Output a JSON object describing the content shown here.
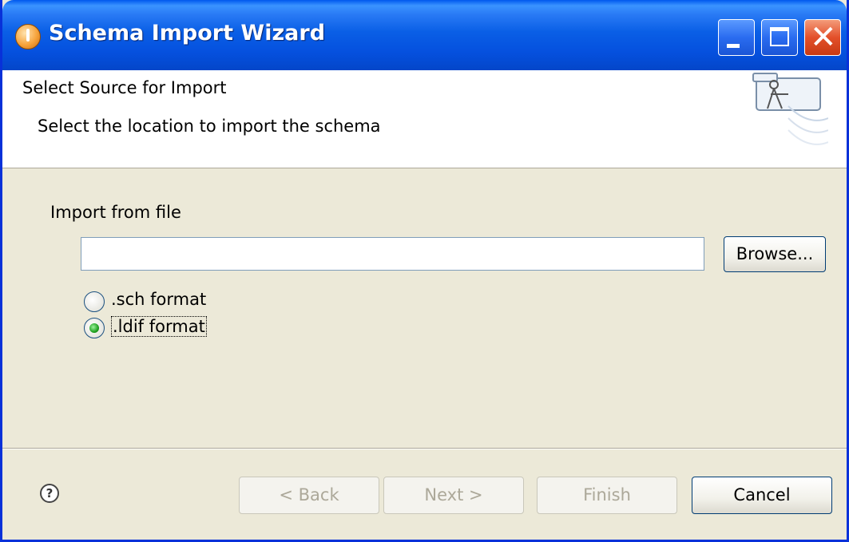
{
  "window": {
    "title": "Schema Import Wizard",
    "controls": {
      "minimize_icon": "minimize-icon",
      "maximize_icon": "maximize-icon",
      "close_icon": "close-icon",
      "close_glyph": "✕"
    }
  },
  "banner": {
    "title": "Select Source for Import",
    "subtitle": "Select the location to import the schema"
  },
  "form": {
    "import_label": "Import from file",
    "file_path": {
      "value": "",
      "placeholder": ""
    },
    "browse_label": "Browse...",
    "formats": [
      {
        "label": ".sch format",
        "selected": false
      },
      {
        "label": ".ldif format",
        "selected": true
      }
    ]
  },
  "footer": {
    "help_glyph": "?",
    "back_label": "< Back",
    "next_label": "Next >",
    "finish_label": "Finish",
    "cancel_label": "Cancel"
  },
  "colors": {
    "titlebar": "#0a5fe6",
    "dialog_bg": "#ece9d8",
    "radio_selected": "#21a121"
  }
}
